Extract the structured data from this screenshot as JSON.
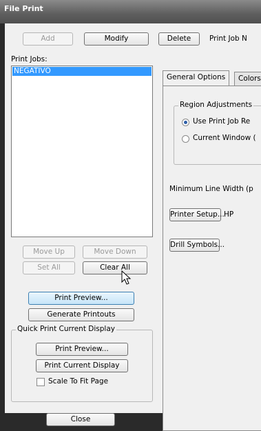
{
  "window": {
    "title": "File Print"
  },
  "toolbar": {
    "add": "Add",
    "modify": "Modify",
    "delete": "Delete",
    "print_job_label": "Print Job N"
  },
  "jobs": {
    "label": "Print Jobs:",
    "items": [
      "NEGATIVO"
    ]
  },
  "buttons": {
    "move_up": "Move Up",
    "move_down": "Move Down",
    "set_all": "Set All",
    "clear_all": "Clear All",
    "print_preview": "Print Preview...",
    "generate_printouts": "Generate Printouts",
    "close": "Close"
  },
  "quick": {
    "title": "Quick Print Current Display",
    "print_preview": "Print Preview...",
    "print_current": "Print Current Display",
    "scale_to_fit": "Scale To Fit Page"
  },
  "tabs": {
    "general": "General Options",
    "colors": "Colors"
  },
  "general": {
    "region_title": "Region Adjustments",
    "use_print_job": "Use Print Job Re",
    "current_window": "Current Window (",
    "min_line_width": "Minimum Line Width (p",
    "printer_setup": "Printer Setup...",
    "printer_name": "HP",
    "drill_symbols": "Drill Symbols..."
  }
}
